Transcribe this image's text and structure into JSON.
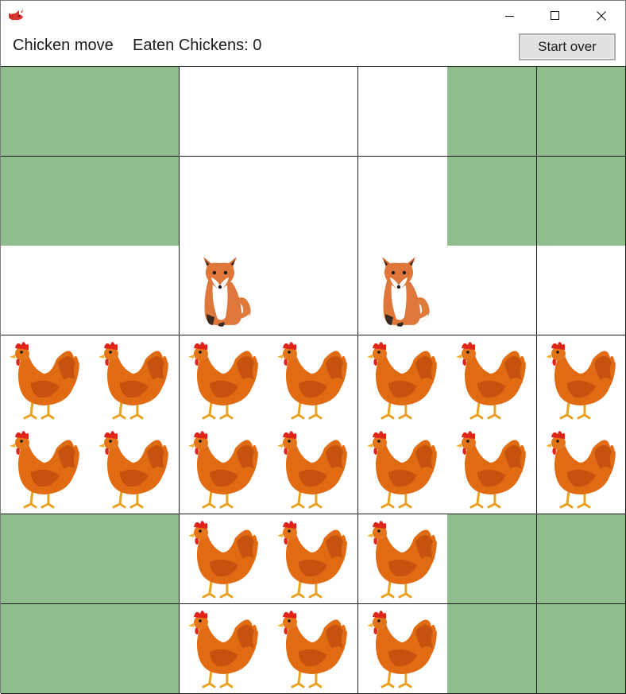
{
  "window": {
    "app_icon": "fox-app-icon",
    "controls": [
      "minimize-icon",
      "maximize-icon",
      "close-icon"
    ]
  },
  "status": {
    "turn_text": "Chicken move",
    "eaten_text": "Eaten Chickens: 0"
  },
  "toolbar": {
    "start_over_label": "Start over"
  },
  "colors": {
    "blocked_cell": "#8fbe8c",
    "open_cell": "#ffffff",
    "grid_line": "#1a1a1a"
  },
  "board": {
    "rows": 7,
    "cols": 7,
    "legend": {
      "X": "blocked",
      ".": "empty",
      "F": "fox",
      "C": "chicken"
    },
    "cells": [
      "XX...XX",
      "XX...XX",
      "..F.F..",
      "CCCCCCC",
      "CCCCCCC",
      "XXCCCXX",
      "XXCCCXX"
    ]
  }
}
